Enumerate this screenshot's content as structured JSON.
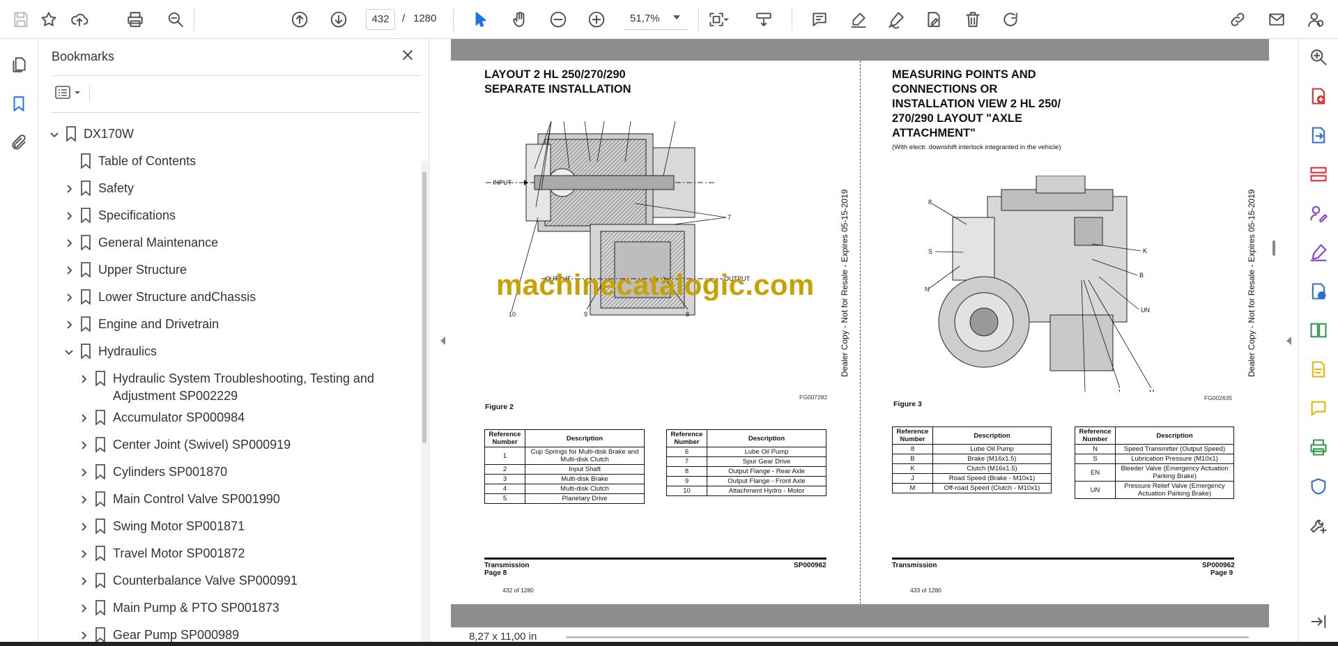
{
  "toolbar": {
    "page_current": "432",
    "page_separator": "/",
    "page_total": "1280",
    "zoom": "51,7%",
    "icons": [
      "save-icon",
      "star-icon",
      "upload-icon",
      "print-icon",
      "find-icon",
      "page-up-icon",
      "page-down-icon",
      "select-cursor-icon",
      "hand-icon",
      "zoom-out-icon",
      "zoom-in-icon",
      "fit-page-icon",
      "scroll-mode-icon",
      "comment-icon",
      "highlight-icon",
      "sign-icon",
      "fill-sign-icon",
      "delete-icon",
      "rotate-icon",
      "share-link-icon",
      "mail-icon",
      "account-icon"
    ]
  },
  "bookmarks": {
    "title": "Bookmarks",
    "items": [
      {
        "label": "DX170W",
        "level": 0,
        "state": "expanded"
      },
      {
        "label": "Table of Contents",
        "level": 1,
        "state": "none"
      },
      {
        "label": "Safety",
        "level": 1,
        "state": "collapsed"
      },
      {
        "label": "Specifications",
        "level": 1,
        "state": "collapsed"
      },
      {
        "label": "General Maintenance",
        "level": 1,
        "state": "collapsed"
      },
      {
        "label": "Upper Structure",
        "level": 1,
        "state": "collapsed"
      },
      {
        "label": "Lower Structure andChassis",
        "level": 1,
        "state": "collapsed"
      },
      {
        "label": "Engine and Drivetrain",
        "level": 1,
        "state": "collapsed"
      },
      {
        "label": "Hydraulics",
        "level": 1,
        "state": "expanded"
      },
      {
        "label": "Hydraulic System Troubleshooting, Testing and Adjustment SP002229",
        "level": 2,
        "state": "collapsed"
      },
      {
        "label": "Accumulator SP000984",
        "level": 2,
        "state": "collapsed"
      },
      {
        "label": "Center Joint (Swivel) SP000919",
        "level": 2,
        "state": "collapsed"
      },
      {
        "label": "Cylinders SP001870",
        "level": 2,
        "state": "collapsed"
      },
      {
        "label": "Main Control Valve SP001990",
        "level": 2,
        "state": "collapsed"
      },
      {
        "label": "Swing Motor SP001871",
        "level": 2,
        "state": "collapsed"
      },
      {
        "label": "Travel Motor SP001872",
        "level": 2,
        "state": "collapsed"
      },
      {
        "label": "Counterbalance Valve SP000991",
        "level": 2,
        "state": "collapsed"
      },
      {
        "label": "Main Pump & PTO SP001873",
        "level": 2,
        "state": "collapsed"
      },
      {
        "label": "Gear Pump SP000989",
        "level": 2,
        "state": "collapsed"
      }
    ]
  },
  "document": {
    "left_page": {
      "title_line1": "LAYOUT 2 HL 250/270/290",
      "title_line2": "SEPARATE INSTALLATION",
      "input_label": "INPUT",
      "output_label_1": "OUTPUT",
      "output_label_2": "OUTPUT",
      "callouts": [
        "1",
        "2",
        "3",
        "4",
        "5",
        "6",
        "7",
        "8",
        "9",
        "10"
      ],
      "fg_code": "FG007282",
      "figure": "Figure 2",
      "table1": {
        "headers": [
          "Reference Number",
          "Description"
        ],
        "rows": [
          [
            "1",
            "Cup Springs for Multi-disk Brake and Multi-disk Clutch"
          ],
          [
            "2",
            "Input Shaft"
          ],
          [
            "3",
            "Multi-disk Brake"
          ],
          [
            "4",
            "Multi-disk Clutch"
          ],
          [
            "5",
            "Planetary Drive"
          ]
        ]
      },
      "table2": {
        "headers": [
          "Reference Number",
          "Description"
        ],
        "rows": [
          [
            "6",
            "Lube Oil Pump"
          ],
          [
            "7",
            "Spur Gear Drive"
          ],
          [
            "8",
            "Output Flange - Rear Axle"
          ],
          [
            "9",
            "Output Flange - Front Axle"
          ],
          [
            "10",
            "Attachment Hydro - Motor"
          ]
        ]
      },
      "footer_left": "Transmission",
      "footer_left2": "Page 8",
      "footer_right": "SP000962",
      "page_of": "432 of 1280",
      "vertical": "Dealer Copy - Not for Resale - Expires 05-15-2019"
    },
    "right_page": {
      "title_lines": [
        "MEASURING POINTS AND",
        "CONNECTIONS OR",
        "INSTALLATION VIEW 2 HL 250/",
        "270/290 LAYOUT \"AXLE",
        "ATTACHMENT\""
      ],
      "subtitle": "(With electr. downshift interlock integranted in the vehicle)",
      "callouts": [
        "8",
        "K",
        "S",
        "B",
        "N",
        "UN",
        "EN",
        "J",
        "M"
      ],
      "fg_code": "FG002635",
      "figure": "Figure 3",
      "table1": {
        "headers": [
          "Reference Number",
          "Description"
        ],
        "rows": [
          [
            "8",
            "Lube Oil Pump"
          ],
          [
            "B",
            "Brake (M16x1.5)"
          ],
          [
            "K",
            "Clutch (M16x1.5)"
          ],
          [
            "J",
            "Road Speed (Brake - M10x1)"
          ],
          [
            "M",
            "Off-road Speed (Clutch - M10x1)"
          ]
        ]
      },
      "table2": {
        "headers": [
          "Reference Number",
          "Description"
        ],
        "rows": [
          [
            "N",
            "Speed Transmitter (Output Speed)"
          ],
          [
            "S",
            "Lubrication Pressure (M10x1)"
          ],
          [
            "EN",
            "Bleeder Valve (Emergency Actuation Parking Brake)"
          ],
          [
            "UN",
            "Pressure Relief Valve (Emergency Actuation Parking Brake)"
          ]
        ]
      },
      "footer_left": "Transmission",
      "footer_right": "SP000962",
      "footer_right2": "Page 9",
      "page_of": "433 of 1280",
      "vertical": "Dealer Copy - Not for Resale - Expires 05-15-2019"
    },
    "watermark": "machinecatalogic.com"
  },
  "status": {
    "page_size": "8,27 x 11,00 in"
  },
  "right_tools": {
    "icons": [
      "zoom-search-icon",
      "create-pdf-icon",
      "export-pdf-icon",
      "organize-pages-icon",
      "request-signature-icon",
      "fill-sign-icon",
      "convert-icon",
      "compare-icon",
      "edit-pdf-icon",
      "comment-icon",
      "print-production-icon",
      "protect-icon",
      "more-tools-icon",
      "collapse-panel-icon"
    ],
    "colors": {
      "red": "#e0312e",
      "blue": "#2c6fd1",
      "purple": "#8a3dd1",
      "green": "#2e9b4e",
      "yellow": "#e8b400",
      "gray": "#555555"
    }
  }
}
